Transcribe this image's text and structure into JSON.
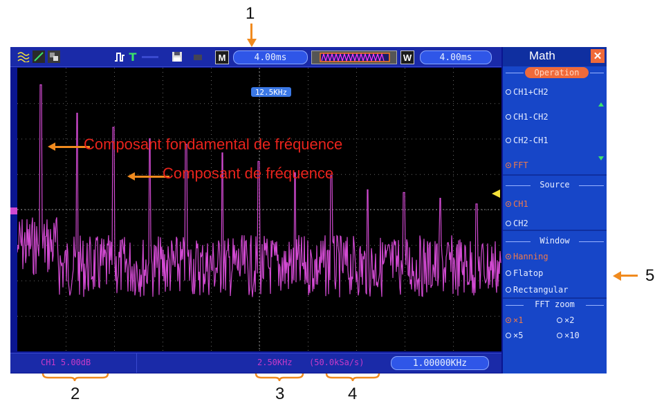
{
  "annotations": {
    "n1": "1",
    "n2": "2",
    "n3": "3",
    "n4": "4",
    "n5": "5",
    "fundamental": "Composant fondamental de fréquence",
    "component": "Composant de fréquence"
  },
  "toolbar": {
    "time_base_1": "4.00ms",
    "mode_m": "M",
    "mode_w": "W",
    "time_base_2": "4.00ms",
    "trigger_t": "T"
  },
  "screen": {
    "marker_freq": "12.5KHz"
  },
  "status": {
    "ch_scale": "CH1 5.00dB",
    "freq_per_div": "2.50KHz",
    "sample_rate": "(50.0kSa/s)",
    "frequency": "1.00000KHz"
  },
  "menu": {
    "title": "Math",
    "close_glyph": "✕",
    "operation_label": "Operation",
    "operations": [
      {
        "label": "CH1+CH2",
        "selected": false
      },
      {
        "label": "CH1-CH2",
        "selected": false
      },
      {
        "label": "CH2-CH1",
        "selected": false
      },
      {
        "label": "FFT",
        "selected": true
      }
    ],
    "source_label": "Source",
    "sources": [
      {
        "label": "CH1",
        "selected": true
      },
      {
        "label": "CH2",
        "selected": false
      }
    ],
    "window_label": "Window",
    "windows": [
      {
        "label": "Hanning",
        "selected": true
      },
      {
        "label": "Flatop",
        "selected": false
      },
      {
        "label": "Rectangular",
        "selected": false
      }
    ],
    "zoom_label": "FFT zoom",
    "zooms": [
      {
        "label": "×1",
        "selected": true
      },
      {
        "label": "×2",
        "selected": false
      },
      {
        "label": "×5",
        "selected": false
      },
      {
        "label": "×10",
        "selected": false
      }
    ]
  },
  "colors": {
    "trace": "#d24ad2",
    "annotation": "#e8231c",
    "arrow": "#f08a1e",
    "selected_option": "#f07a4a"
  },
  "chart_data": {
    "type": "line",
    "title": "",
    "xlabel": "",
    "ylabel": "",
    "peaks_relative_height": [
      0.94,
      0.84,
      0.79,
      0.75,
      0.73,
      0.7,
      0.67,
      0.63,
      0.62,
      0.57,
      0.56,
      0.54,
      0.52
    ],
    "noise_floor_relative_height": 0.3
  }
}
